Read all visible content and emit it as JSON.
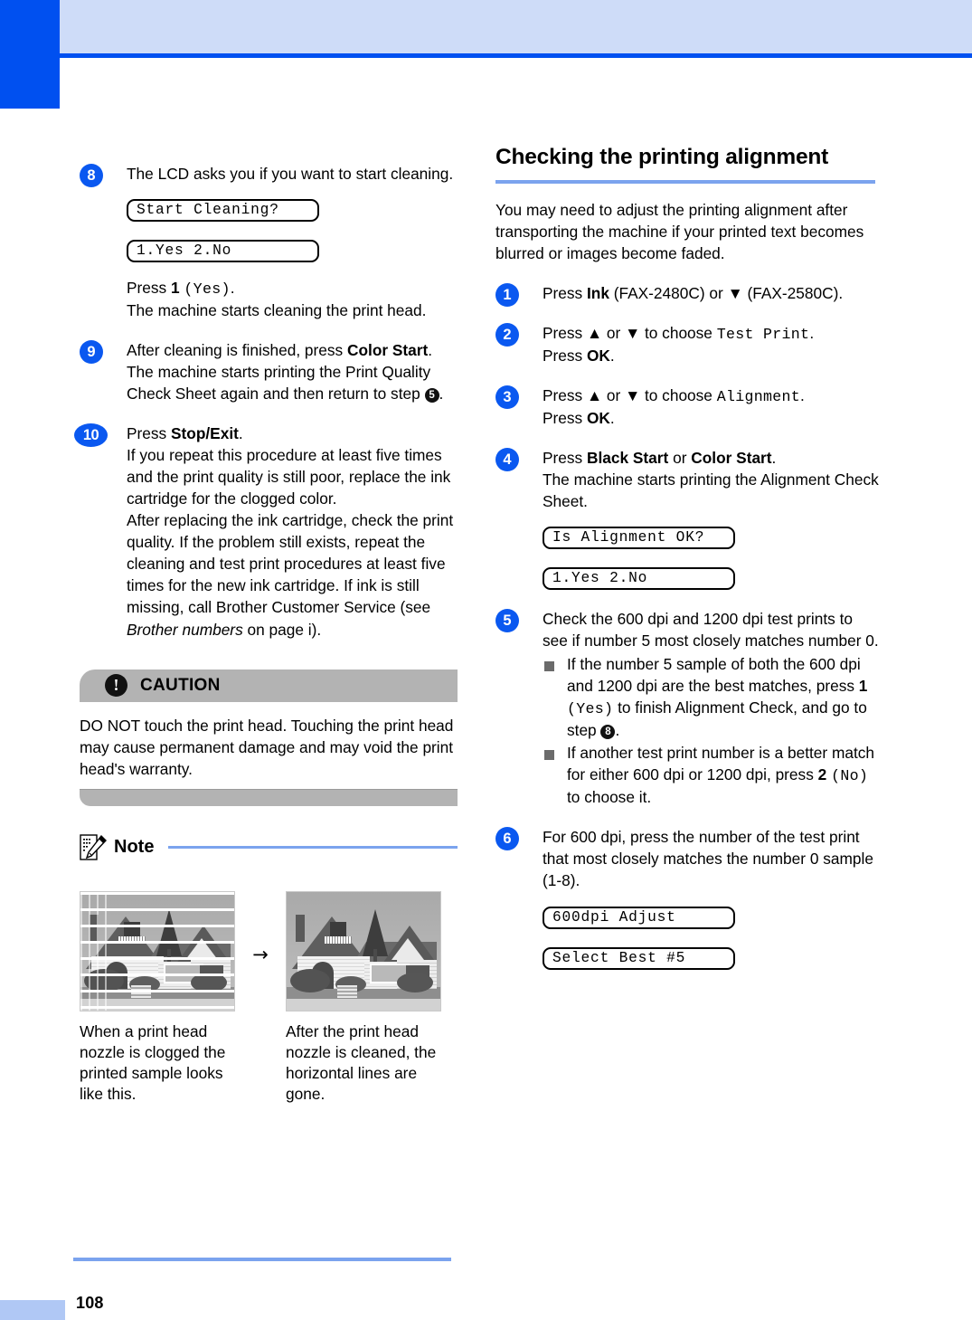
{
  "page": {
    "number": "108",
    "accent_blue": "#0050f0",
    "header_blue": "#cedcf8",
    "rule_blue": "#7ba3ee",
    "badge_blue": "#0a58f0",
    "caution_gray": "#b3b3b3"
  },
  "left_column": {
    "steps": [
      {
        "num": "8",
        "lines": [
          "The LCD asks you if you want to start cleaning."
        ],
        "lcd": [
          "Start Cleaning?",
          "1.Yes 2.No"
        ],
        "after_lines": [
          "Press 1 (Yes).",
          "The machine starts cleaning the print head."
        ],
        "press_label": "Press ",
        "press_key": "1",
        "press_mono": "(Yes)",
        "press_tail": ".",
        "after_text": "The machine starts cleaning the print head."
      },
      {
        "num": "9",
        "intro_a": "After cleaning is finished, press ",
        "intro_bold": "Color Start",
        "intro_b": ".",
        "body": "The machine starts printing the Print Quality Check Sheet again and then return to step ",
        "ref": "5",
        "body_tail": "."
      },
      {
        "num": "10",
        "intro_a": "Press ",
        "intro_bold": "Stop/Exit",
        "intro_b": ".",
        "body_1": "If you repeat this procedure at least five times and the print quality is still poor, replace the ink cartridge for the clogged color.",
        "body_2": "After replacing the ink cartridge, check the print quality. If the problem still exists, repeat the cleaning and test print procedures at least five times for the new ink cartridge. If ink is still missing, call Brother Customer Service (see ",
        "body_italic": "Brother numbers",
        "body_3": " on page i)."
      }
    ],
    "caution": {
      "icon": "exclamation-icon",
      "title": "CAUTION",
      "body": "DO NOT touch the print head. Touching the print head may cause permanent damage and may void the print head's warranty."
    },
    "note": {
      "icon": "note-pencil-icon",
      "title": "Note"
    },
    "figures": [
      {
        "image_name": "clogged-nozzle-sample",
        "caption": "When a print head nozzle is clogged the printed sample looks like this."
      },
      {
        "image_name": "cleaned-nozzle-sample",
        "caption": "After the print head nozzle is cleaned, the horizontal lines are gone."
      }
    ],
    "figure_arrow": "→"
  },
  "right_column": {
    "heading": "Checking the printing alignment",
    "intro": "You may need to adjust the printing alignment after transporting the machine if your printed text becomes blurred or images become faded.",
    "steps": [
      {
        "num": "1",
        "pre": "Press ",
        "bold": "Ink",
        "mid": " (FAX-2480C) or ",
        "arrow": "▼",
        "post": " (FAX-2580C)."
      },
      {
        "num": "2",
        "pre": "Press ",
        "up": "▲",
        "or": " or ",
        "down": "▼",
        "mid": " to choose ",
        "mono": "Test Print",
        "post": ".",
        "line2_pre": "Press ",
        "line2_bold": "OK",
        "line2_post": "."
      },
      {
        "num": "3",
        "pre": "Press ",
        "up": "▲",
        "or": " or ",
        "down": "▼",
        "mid": " to choose ",
        "mono": "Alignment",
        "post": ".",
        "line2_pre": "Press ",
        "line2_bold": "OK",
        "line2_post": "."
      },
      {
        "num": "4",
        "pre": "Press ",
        "bold_1": "Black Start",
        "mid": " or ",
        "bold_2": "Color Start",
        "post": ".",
        "body": "The machine starts printing the Alignment Check Sheet.",
        "lcd": [
          "Is Alignment OK?",
          "1.Yes 2.No"
        ]
      },
      {
        "num": "5",
        "body": "Check the 600 dpi and 1200 dpi test prints to see if number 5 most closely matches number 0.",
        "bullets": [
          {
            "pre": "If the number 5 sample of both the 600 dpi and 1200 dpi are the best matches, press ",
            "key": "1",
            "mono": "(Yes)",
            "mid": " to finish Alignment Check, and go to step ",
            "ref": "8",
            "post": "."
          },
          {
            "pre": "If another test print number is a better match for either 600 dpi or 1200 dpi, press ",
            "key": "2",
            "mono": "(No)",
            "mid": " to choose it.",
            "ref": "",
            "post": ""
          }
        ]
      },
      {
        "num": "6",
        "body": "For 600 dpi, press the number of the test print that most closely matches the number 0 sample (1-8).",
        "lcd": [
          "600dpi Adjust",
          "Select Best #5"
        ]
      }
    ]
  }
}
